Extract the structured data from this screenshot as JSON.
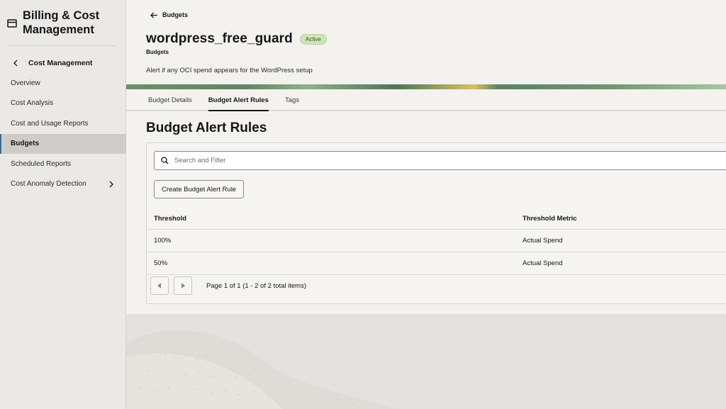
{
  "sidebar": {
    "app_title": "Billing & Cost Management",
    "back_label": "Cost Management",
    "items": [
      {
        "label": "Overview"
      },
      {
        "label": "Cost Analysis"
      },
      {
        "label": "Cost and Usage Reports"
      },
      {
        "label": "Budgets",
        "active": true
      },
      {
        "label": "Scheduled Reports"
      },
      {
        "label": "Cost Anomaly Detection",
        "has_submenu": true
      }
    ]
  },
  "header": {
    "breadcrumb": "Budgets",
    "title": "wordpress_free_guard",
    "status_badge": "Active",
    "subtitle": "Budgets",
    "description": "Alert if any OCI spend appears for the WordPress setup"
  },
  "tabs": [
    {
      "label": "Budget Details"
    },
    {
      "label": "Budget Alert Rules",
      "active": true
    },
    {
      "label": "Tags"
    }
  ],
  "section": {
    "title": "Budget Alert Rules",
    "search_placeholder": "Search and Filter",
    "create_button": "Create Budget Alert Rule"
  },
  "table": {
    "columns": [
      "Threshold",
      "Threshold Metric"
    ],
    "rows": [
      [
        "100%",
        "Actual Spend"
      ],
      [
        "50%",
        "Actual Spend"
      ]
    ]
  },
  "pagination": {
    "text": "Page 1 of 1 (1 - 2 of 2 total items)"
  },
  "colors": {
    "badge_bg": "#cfe3b8",
    "active_nav": "#cfccc8"
  }
}
